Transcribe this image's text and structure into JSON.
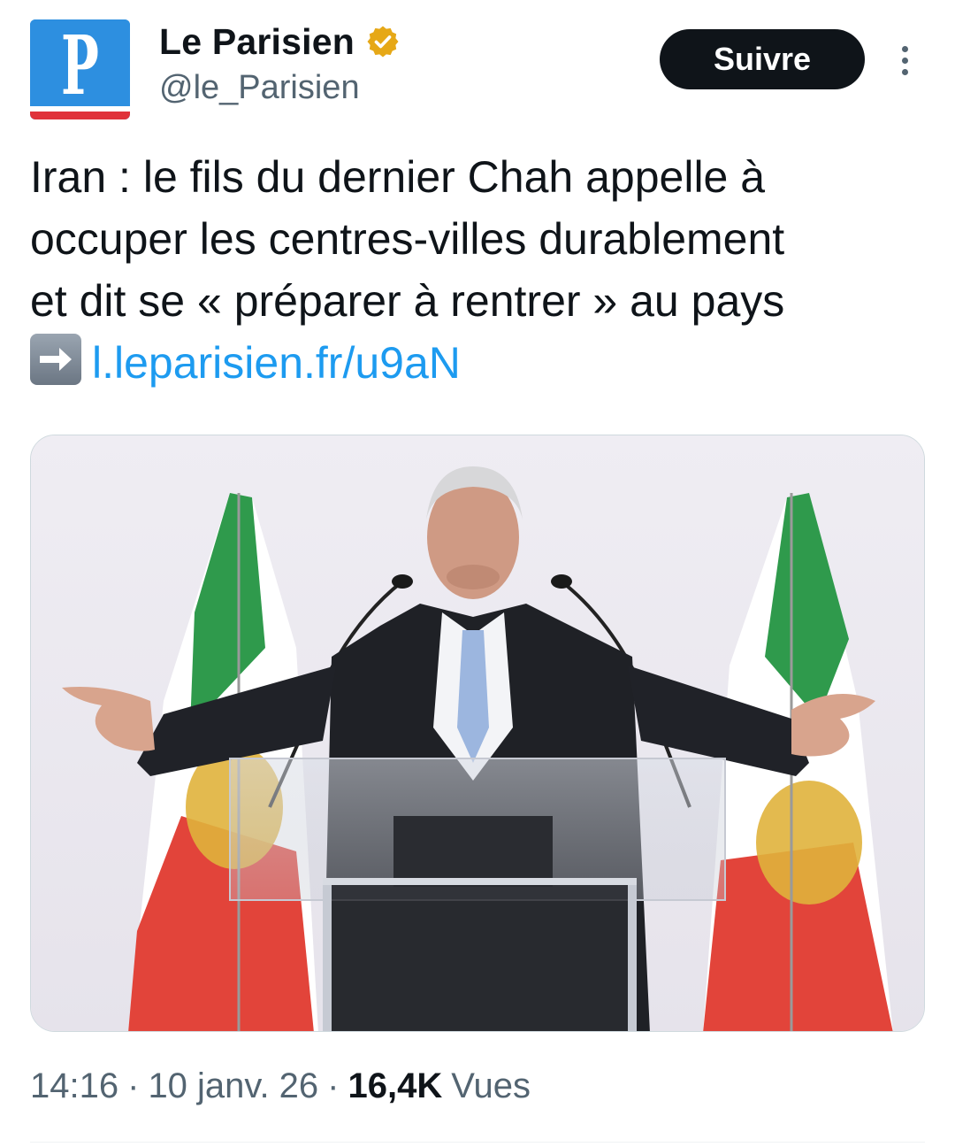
{
  "account": {
    "name": "Le Parisien",
    "handle": "@le_Parisien",
    "avatar_letter": "P",
    "verified": true,
    "verified_color": "#e6a817"
  },
  "actions": {
    "follow_label": "Suivre",
    "more_icon": "more-vertical-icon"
  },
  "tweet": {
    "lines": [
      "Iran : le fils du dernier Chah appelle à",
      "occuper les centres-villes durablement",
      "et dit se « préparer à rentrer » au pays"
    ],
    "arrow_icon": "right-arrow-emoji-icon",
    "link": "l.leparisien.fr/u9aN"
  },
  "media": {
    "type": "photo"
  },
  "meta": {
    "time": "14:16",
    "separator": "·",
    "date": "10 janv. 26",
    "views_count": "16,4K",
    "views_label": "Vues"
  },
  "colors": {
    "text": "#0f1419",
    "secondary": "#536471",
    "link": "#1d9bf0",
    "button": "#0f1419",
    "brand_blue": "#2d8fe0",
    "brand_red": "#e0323a"
  }
}
